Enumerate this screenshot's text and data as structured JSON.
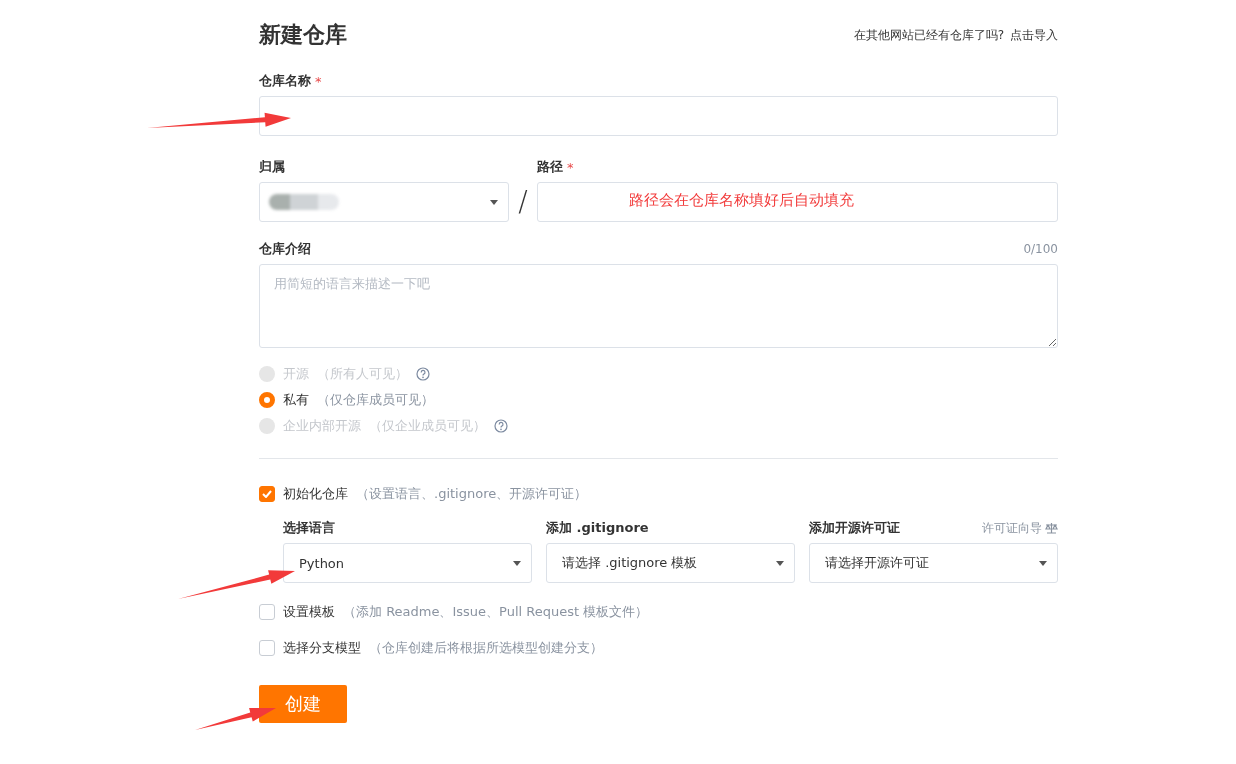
{
  "header": {
    "title": "新建仓库",
    "import_hint": "在其他网站已经有仓库了吗?",
    "import_link": "点击导入"
  },
  "repo_name": {
    "label": "仓库名称",
    "required_mark": "*"
  },
  "owner": {
    "label": "归属"
  },
  "separator": "/",
  "path": {
    "label": "路径",
    "required_mark": "*",
    "annotation": "路径会在仓库名称填好后自动填充"
  },
  "description": {
    "label": "仓库介绍",
    "counter": "0/100",
    "placeholder": "用简短的语言来描述一下吧"
  },
  "visibility": [
    {
      "label": "开源",
      "note": "（所有人可见）",
      "selected": false,
      "disabled": true,
      "help": true
    },
    {
      "label": "私有",
      "note": "（仅仓库成员可见）",
      "selected": true,
      "disabled": false,
      "help": false
    },
    {
      "label": "企业内部开源",
      "note": "（仅企业成员可见）",
      "selected": false,
      "disabled": true,
      "help": true
    }
  ],
  "init": {
    "label": "初始化仓库",
    "note": "（设置语言、.gitignore、开源许可证）",
    "checked": true
  },
  "selects": [
    {
      "label": "选择语言",
      "value": "Python"
    },
    {
      "label": "添加 .gitignore",
      "value": "请选择 .gitignore 模板"
    },
    {
      "label": "添加开源许可证",
      "value": "请选择开源许可证",
      "link": "许可证向导"
    }
  ],
  "options": [
    {
      "label": "设置模板",
      "note": "（添加 Readme、Issue、Pull Request 模板文件）",
      "checked": false
    },
    {
      "label": "选择分支模型",
      "note": "（仓库创建后将根据所选模型创建分支）",
      "checked": false
    }
  ],
  "submit": "创建"
}
